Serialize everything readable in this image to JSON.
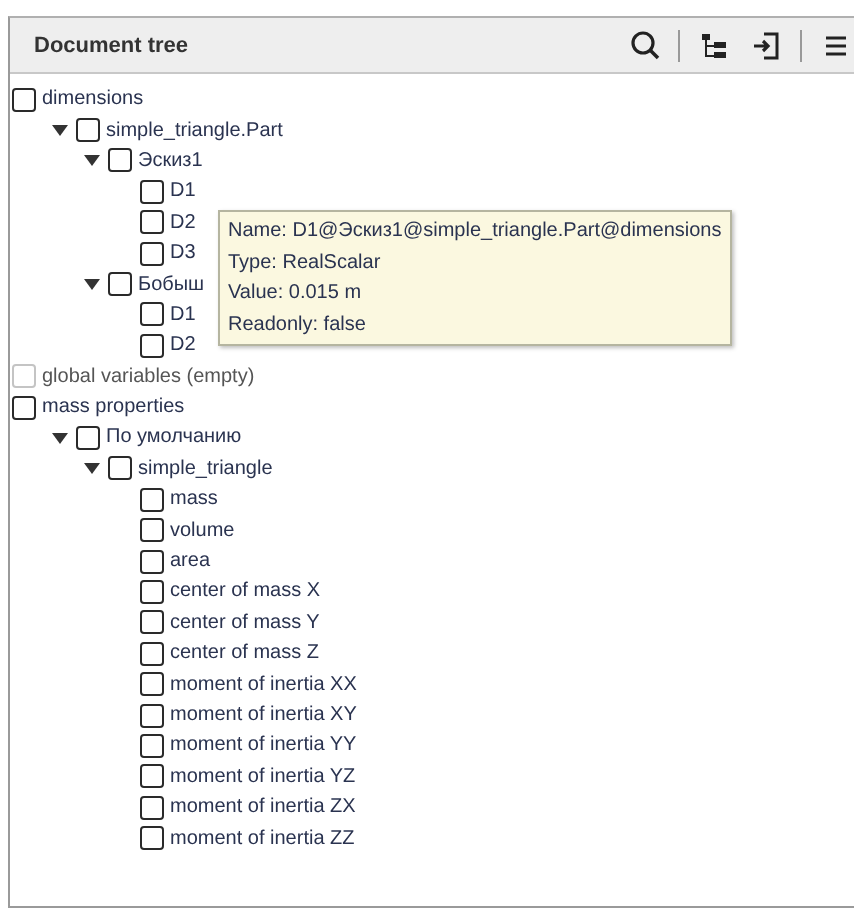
{
  "panel": {
    "title": "Document tree"
  },
  "toolbar": [
    {
      "kind": "search"
    },
    {
      "kind": "divider"
    },
    {
      "kind": "tree"
    },
    {
      "kind": "import"
    },
    {
      "kind": "divider"
    },
    {
      "kind": "menu"
    }
  ],
  "tree": [
    {
      "label": "dimensions",
      "checked": false,
      "disabled": false,
      "children": [
        {
          "label": "simple_triangle.Part",
          "checked": false,
          "disabled": false,
          "expanded": true,
          "children": [
            {
              "label": "Эскиз1",
              "checked": false,
              "disabled": false,
              "expanded": true,
              "children": [
                {
                  "label": "D1",
                  "checked": false,
                  "disabled": false
                },
                {
                  "label": "D2",
                  "checked": false,
                  "disabled": false
                },
                {
                  "label": "D3",
                  "checked": false,
                  "disabled": false
                }
              ]
            },
            {
              "label": "Бобыш",
              "checked": false,
              "disabled": false,
              "expanded": true,
              "children": [
                {
                  "label": "D1",
                  "checked": false,
                  "disabled": false
                },
                {
                  "label": "D2",
                  "checked": false,
                  "disabled": false
                }
              ]
            }
          ]
        }
      ]
    },
    {
      "label": "global variables (empty)",
      "checked": false,
      "disabled": true
    },
    {
      "label": "mass properties",
      "checked": false,
      "disabled": false,
      "children": [
        {
          "label": "По умолчанию",
          "checked": false,
          "disabled": false,
          "expanded": true,
          "children": [
            {
              "label": "simple_triangle",
              "checked": false,
              "disabled": false,
              "expanded": true,
              "children": [
                {
                  "label": "mass",
                  "checked": false,
                  "disabled": false
                },
                {
                  "label": "volume",
                  "checked": false,
                  "disabled": false
                },
                {
                  "label": "area",
                  "checked": false,
                  "disabled": false
                },
                {
                  "label": "center of mass X",
                  "checked": false,
                  "disabled": false
                },
                {
                  "label": "center of mass Y",
                  "checked": false,
                  "disabled": false
                },
                {
                  "label": "center of mass Z",
                  "checked": false,
                  "disabled": false
                },
                {
                  "label": "moment of inertia XX",
                  "checked": false,
                  "disabled": false
                },
                {
                  "label": "moment of inertia XY",
                  "checked": false,
                  "disabled": false
                },
                {
                  "label": "moment of inertia YY",
                  "checked": false,
                  "disabled": false
                },
                {
                  "label": "moment of inertia YZ",
                  "checked": false,
                  "disabled": false
                },
                {
                  "label": "moment of inertia ZX",
                  "checked": false,
                  "disabled": false
                },
                {
                  "label": "moment of inertia ZZ",
                  "checked": false,
                  "disabled": false
                }
              ]
            }
          ]
        }
      ]
    }
  ],
  "tooltip": {
    "lines": [
      "Name: D1@Эскиз1@simple_triangle.Part@dimensions",
      "Type: RealScalar",
      "Value: 0.015 m",
      "Readonly: false"
    ]
  }
}
